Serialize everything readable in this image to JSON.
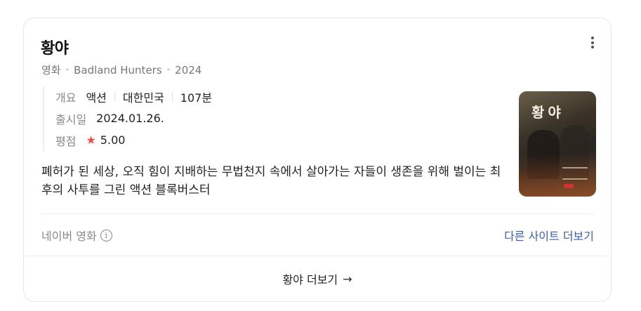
{
  "card": {
    "title": "황야",
    "subtitle": {
      "category": "영화",
      "english_title": "Badland Hunters",
      "year": "2024"
    },
    "info": {
      "overview_label": "개요",
      "genre": "액션",
      "country": "대한민국",
      "runtime": "107분",
      "release_label": "출시일",
      "release_date": "2024.01.26.",
      "rating_label": "평점",
      "rating_value": "5.00"
    },
    "description": "폐허가 된 세상, 오직 힘이 지배하는 무법천지 속에서 살아가는 자들이 생존을 위해 벌이는 최후의 사투를 그린 액션 블록버스터",
    "poster": {
      "title_text": "황 야"
    },
    "source_label": "네이버 영화",
    "other_sites_link": "다른 사이트 더보기",
    "more_label": "황야 더보기",
    "more_arrow": "→"
  },
  "colors": {
    "star": "#f24a4a",
    "link": "#3b5fa6"
  },
  "icons": {
    "menu": "more-vertical-icon",
    "info": "info-circle-icon",
    "star": "star-icon",
    "arrow": "arrow-right-icon"
  }
}
